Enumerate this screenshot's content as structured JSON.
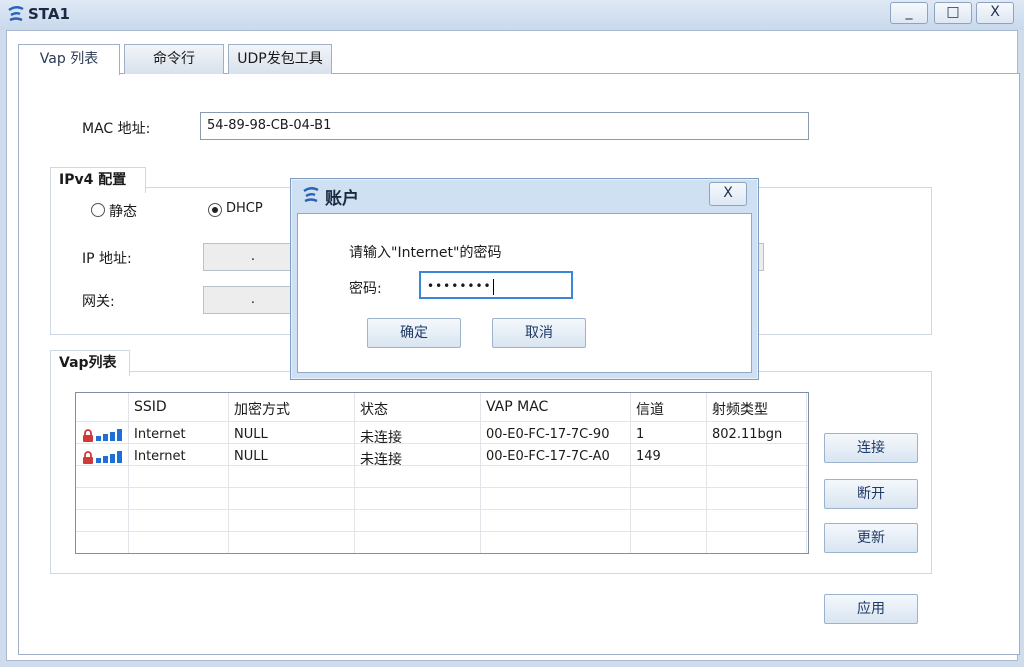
{
  "window": {
    "title": "STA1",
    "minimize": "_",
    "maximize": "□",
    "close": "X"
  },
  "tabs": [
    {
      "label": "Vap 列表",
      "active": true
    },
    {
      "label": "命令行",
      "active": false
    },
    {
      "label": "UDP发包工具",
      "active": false
    }
  ],
  "mac": {
    "label": "MAC 地址:",
    "value": "54-89-98-CB-04-B1"
  },
  "ipv4": {
    "group_title": "IPv4 配置",
    "static_label": "静态",
    "dhcp_label": "DHCP",
    "mode": "DHCP",
    "ip_label": "IP 地址:",
    "ip_value": ".",
    "gateway_label": "网关:",
    "gateway_value": "."
  },
  "vap": {
    "group_title": "Vap列表",
    "columns": [
      "SSID",
      "加密方式",
      "状态",
      "VAP MAC",
      "信道",
      "射频类型"
    ],
    "rows": [
      [
        "Internet",
        "NULL",
        "未连接",
        "00-E0-FC-17-7C-90",
        "1",
        "802.11bgn"
      ],
      [
        "Internet",
        "NULL",
        "未连接",
        "00-E0-FC-17-7C-A0",
        "149",
        ""
      ]
    ],
    "buttons": {
      "connect": "连接",
      "disconnect": "断开",
      "refresh": "更新"
    }
  },
  "apply_button": "应用",
  "dialog": {
    "title": "账户",
    "close": "X",
    "prompt": "请输入\"Internet\"的密码",
    "password_label": "密码:",
    "password_value": "••••••••",
    "ok": "确定",
    "cancel": "取消"
  },
  "colors": {
    "accent": "#1f3a66",
    "signal_bar": "#1f6fd6",
    "lock": "#d23a3a"
  },
  "icons": [
    "ensp-logo-icon",
    "lock-icon",
    "signal-strength-icon"
  ]
}
